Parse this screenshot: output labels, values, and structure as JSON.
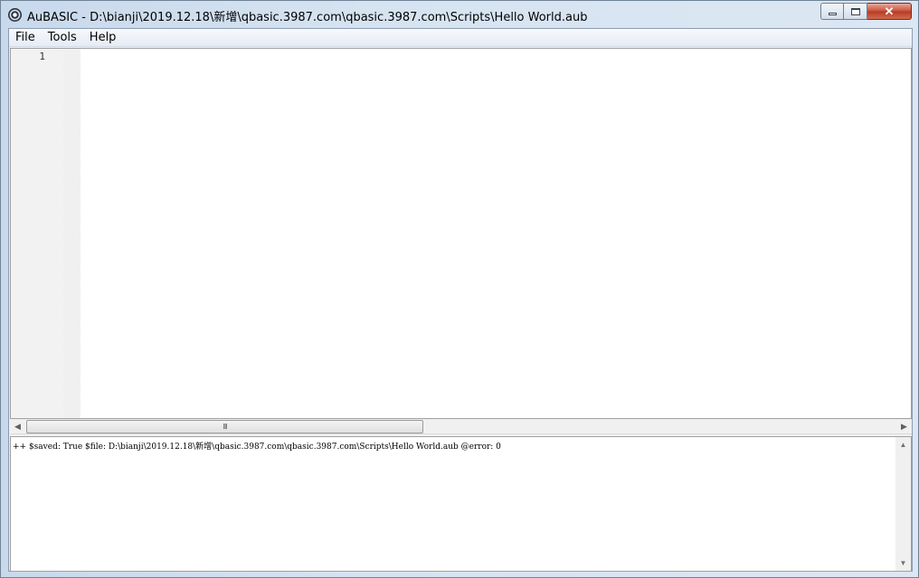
{
  "window": {
    "title": "AuBASIC - D:\\bianji\\2019.12.18\\新增\\qbasic.3987.com\\qbasic.3987.com\\Scripts\\Hello World.aub",
    "app_icon": "aubasic-app-icon",
    "buttons": {
      "minimize_icon": "minimize-icon",
      "maximize_icon": "maximize-icon",
      "close_icon": "close-icon",
      "close_glyph": "✕"
    }
  },
  "menubar": {
    "items": [
      {
        "label": "File"
      },
      {
        "label": "Tools"
      },
      {
        "label": "Help"
      }
    ]
  },
  "editor": {
    "line_numbers": [
      "1"
    ],
    "content": ""
  },
  "hscrollbar": {
    "left_arrow": "◀",
    "right_arrow": "▶",
    "grip": "III"
  },
  "output": {
    "text": "++ $saved: True $file: D:\\bianji\\2019.12.18\\新增\\qbasic.3987.com\\qbasic.3987.com\\Scripts\\Hello World.aub @error: 0",
    "up_arrow": "▲",
    "down_arrow": "▼"
  },
  "colors": {
    "frame": "#d6e3f1",
    "close_button": "#c7503a",
    "gutter": "#f2f2f2"
  }
}
